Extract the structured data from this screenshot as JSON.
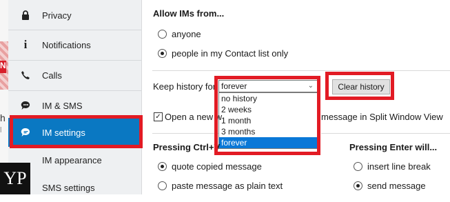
{
  "sidebar": {
    "items": [
      {
        "label": "Privacy",
        "icon": "lock-icon"
      },
      {
        "label": "Notifications",
        "icon": "info-icon"
      },
      {
        "label": "Calls",
        "icon": "phone-icon"
      },
      {
        "label": "IM & SMS",
        "icon": "chat-icon"
      },
      {
        "label": "IM settings",
        "icon": "chat-bubble-icon",
        "active": true
      },
      {
        "label": "IM appearance"
      },
      {
        "label": "SMS settings"
      }
    ]
  },
  "background": {
    "letter1": "N",
    "letter2": "h",
    "letter3": "l"
  },
  "allow_ims": {
    "title": "Allow IMs from...",
    "options": [
      "anyone",
      "people in my Contact list only"
    ],
    "selected_index": 1
  },
  "history": {
    "label": "Keep history for",
    "selected": "forever",
    "options": [
      "no history",
      "2 weeks",
      "1 month",
      "3 months",
      "forever"
    ],
    "clear_button": "Clear history"
  },
  "split_window": {
    "text_start": "Open a new w",
    "text_end": "message in Split Window View",
    "checked": true,
    "checkmark": "✓"
  },
  "ctrl_v": {
    "title": "Pressing Ctrl+V",
    "options": [
      "quote copied message",
      "paste message as plain text"
    ],
    "selected_index": 0
  },
  "enter": {
    "title": "Pressing Enter will...",
    "options": [
      "insert line break",
      "send message"
    ],
    "selected_index": 1
  },
  "logo": {
    "text": "YP"
  },
  "colors": {
    "accent": "#0a78c2",
    "highlight_box": "#e21b24"
  }
}
